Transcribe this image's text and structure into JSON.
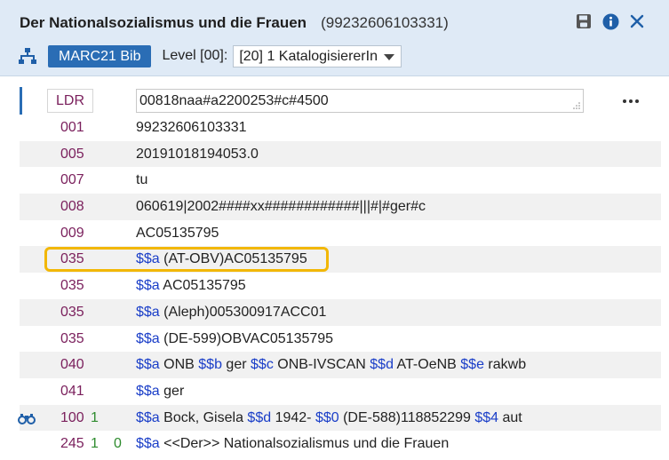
{
  "header": {
    "title": "Der Nationalsozialismus und die Frauen",
    "record_id": "(99232606103331)",
    "icons": [
      "save-icon",
      "info-icon",
      "close-icon"
    ]
  },
  "toolbar": {
    "format_button": "MARC21 Bib",
    "level_label": "Level [00]:",
    "level_value": "[20] 1 KatalogisiererIn"
  },
  "ldr": {
    "tag": "LDR",
    "value": "00818naa#a2200253#c#4500"
  },
  "fields": [
    {
      "tag": "001",
      "ind1": "",
      "ind2": "",
      "value": "99232606103331"
    },
    {
      "tag": "005",
      "ind1": "",
      "ind2": "",
      "value": "20191018194053.0"
    },
    {
      "tag": "007",
      "ind1": "",
      "ind2": "",
      "value": "tu"
    },
    {
      "tag": "008",
      "ind1": "",
      "ind2": "",
      "value": "060619|2002####xx############|||#|#ger#c"
    },
    {
      "tag": "009",
      "ind1": "",
      "ind2": "",
      "value": "AC05135795"
    },
    {
      "tag": "035",
      "ind1": "",
      "ind2": "",
      "sub": [
        [
          "$$a",
          "(AT-OBV)AC05135795"
        ]
      ]
    },
    {
      "tag": "035",
      "ind1": "",
      "ind2": "",
      "sub": [
        [
          "$$a",
          "AC05135795"
        ]
      ]
    },
    {
      "tag": "035",
      "ind1": "",
      "ind2": "",
      "sub": [
        [
          "$$a",
          "(Aleph)005300917ACC01"
        ]
      ]
    },
    {
      "tag": "035",
      "ind1": "",
      "ind2": "",
      "sub": [
        [
          "$$a",
          "(DE-599)OBVAC05135795"
        ]
      ]
    },
    {
      "tag": "040",
      "ind1": "",
      "ind2": "",
      "sub": [
        [
          "$$a",
          "ONB"
        ],
        [
          "$$b",
          "ger"
        ],
        [
          "$$c",
          "ONB-IVSCAN"
        ],
        [
          "$$d",
          "AT-OeNB"
        ],
        [
          "$$e",
          "rakwb"
        ]
      ]
    },
    {
      "tag": "041",
      "ind1": "",
      "ind2": "",
      "sub": [
        [
          "$$a",
          "ger"
        ]
      ]
    },
    {
      "tag": "100",
      "ind1": "1",
      "ind2": "",
      "sub": [
        [
          "$$a",
          "Bock, Gisela"
        ],
        [
          "$$d",
          "1942-"
        ],
        [
          "$$0",
          "(DE-588)118852299"
        ],
        [
          "$$4",
          "aut"
        ]
      ]
    },
    {
      "tag": "245",
      "ind1": "1",
      "ind2": "0",
      "sub": [
        [
          "$$a",
          "<<Der>> Nationalsozialismus und die Frauen"
        ]
      ]
    }
  ],
  "highlighted_field_index": 5,
  "colors": {
    "header_bg": "#dfeaf6",
    "accent": "#2a6db5",
    "tag": "#7a1f5c",
    "indicator": "#2e8b2e",
    "subfield_code": "#1a3ec8",
    "highlight": "#f2b705"
  }
}
